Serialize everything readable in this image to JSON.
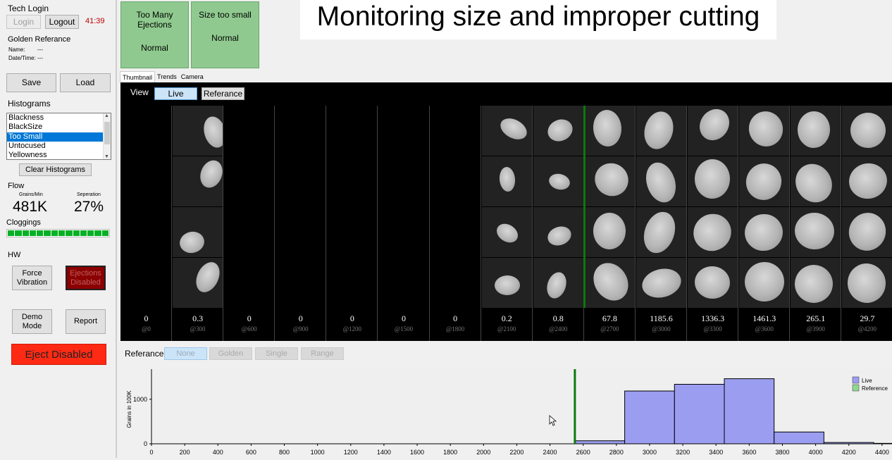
{
  "left": {
    "tech_login": "Tech Login",
    "login_label": "Login",
    "logout_label": "Logout",
    "timer": "41:39",
    "golden_ref_title": "Golden Referance",
    "name_label": "Name:",
    "name_value": "---",
    "datetime_label": "Date/Time:",
    "datetime_value": "---",
    "save_label": "Save",
    "load_label": "Load",
    "histograms_title": "Histograms",
    "histogram_items": [
      "Blackness",
      "BlackSize",
      "Too Small",
      "Untocused",
      "Yellowness"
    ],
    "clear_histograms_label": "Clear Histograms",
    "flow_title": "Flow",
    "grains_label": "Grains/Min",
    "grains_value": "481K",
    "separation_label": "Seperation",
    "separation_value": "27%",
    "cloggings_title": "Cloggings",
    "hw_title": "HW",
    "force_vibration_label": "Force Vibration",
    "ejections_disabled_label": "Ejections Disabled",
    "demo_mode_label": "Demo Mode",
    "report_label": "Report",
    "eject_disabled_label": "Eject Disabled"
  },
  "status": [
    {
      "title": "Too Many Ejections",
      "state": "Normal"
    },
    {
      "title": "Size too small",
      "state": "Normal"
    }
  ],
  "caption": "Monitoring size and improper cutting",
  "tabs": [
    "Thumbnail",
    "Trends",
    "Camera"
  ],
  "viewer": {
    "view_label": "View",
    "live_label": "Live",
    "reference_label": "Referance",
    "columns": [
      {
        "value": "0",
        "pos": "@0"
      },
      {
        "value": "0.3",
        "pos": "@300"
      },
      {
        "value": "0",
        "pos": "@600"
      },
      {
        "value": "0",
        "pos": "@900"
      },
      {
        "value": "0",
        "pos": "@1200"
      },
      {
        "value": "0",
        "pos": "@1500"
      },
      {
        "value": "0",
        "pos": "@1800"
      },
      {
        "value": "0.2",
        "pos": "@2100"
      },
      {
        "value": "0.8",
        "pos": "@2400"
      },
      {
        "value": "67.8",
        "pos": "@2700"
      },
      {
        "value": "1185.6",
        "pos": "@3000"
      },
      {
        "value": "1336.3",
        "pos": "@3300"
      },
      {
        "value": "1461.3",
        "pos": "@3600"
      },
      {
        "value": "265.1",
        "pos": "@3900"
      },
      {
        "value": "29.7",
        "pos": "@4200"
      }
    ]
  },
  "reference_bar": {
    "label": "Referance",
    "options": [
      "None",
      "Golden",
      "Single",
      "Range"
    ]
  },
  "colors": {
    "live_bar": "#9b9ef0",
    "reference": "#8fd88f",
    "marker": "#0a7a0a",
    "eject": "#ff2a14"
  },
  "chart_data": {
    "type": "bar",
    "ylabel": "Grains in 100K",
    "yticks": [
      0,
      1000
    ],
    "xticks": [
      0,
      200,
      400,
      600,
      800,
      1000,
      1200,
      1400,
      1600,
      1800,
      2000,
      2200,
      2400,
      2600,
      2800,
      3000,
      3200,
      3400,
      3600,
      3800,
      4000,
      4200,
      4400
    ],
    "xlim": [
      0,
      4460
    ],
    "ylim": [
      0,
      1550
    ],
    "marker_x": 2550,
    "legend": [
      "Live",
      "Reference"
    ],
    "legend_position": "top-right",
    "bins": [
      {
        "x0": 2550,
        "x1": 2850,
        "value": 67.8
      },
      {
        "x0": 2850,
        "x1": 3150,
        "value": 1185.6
      },
      {
        "x0": 3150,
        "x1": 3450,
        "value": 1336.3
      },
      {
        "x0": 3450,
        "x1": 3750,
        "value": 1461.3
      },
      {
        "x0": 3750,
        "x1": 4050,
        "value": 265.1
      },
      {
        "x0": 4050,
        "x1": 4350,
        "value": 29.7
      },
      {
        "x0": 4350,
        "x1": 4460,
        "value": 10
      }
    ]
  }
}
